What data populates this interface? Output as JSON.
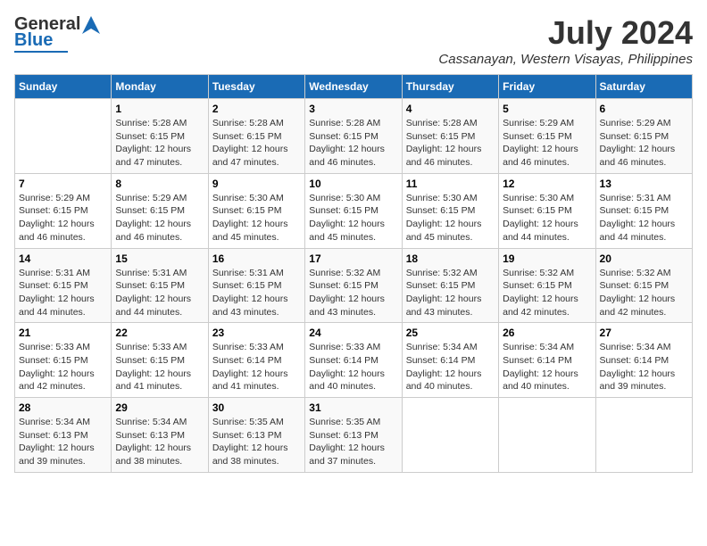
{
  "header": {
    "logo_line1": "General",
    "logo_line2": "Blue",
    "month_year": "July 2024",
    "location": "Cassanayan, Western Visayas, Philippines"
  },
  "columns": [
    "Sunday",
    "Monday",
    "Tuesday",
    "Wednesday",
    "Thursday",
    "Friday",
    "Saturday"
  ],
  "weeks": [
    [
      {
        "day": "",
        "info": ""
      },
      {
        "day": "1",
        "info": "Sunrise: 5:28 AM\nSunset: 6:15 PM\nDaylight: 12 hours\nand 47 minutes."
      },
      {
        "day": "2",
        "info": "Sunrise: 5:28 AM\nSunset: 6:15 PM\nDaylight: 12 hours\nand 47 minutes."
      },
      {
        "day": "3",
        "info": "Sunrise: 5:28 AM\nSunset: 6:15 PM\nDaylight: 12 hours\nand 46 minutes."
      },
      {
        "day": "4",
        "info": "Sunrise: 5:28 AM\nSunset: 6:15 PM\nDaylight: 12 hours\nand 46 minutes."
      },
      {
        "day": "5",
        "info": "Sunrise: 5:29 AM\nSunset: 6:15 PM\nDaylight: 12 hours\nand 46 minutes."
      },
      {
        "day": "6",
        "info": "Sunrise: 5:29 AM\nSunset: 6:15 PM\nDaylight: 12 hours\nand 46 minutes."
      }
    ],
    [
      {
        "day": "7",
        "info": "Sunrise: 5:29 AM\nSunset: 6:15 PM\nDaylight: 12 hours\nand 46 minutes."
      },
      {
        "day": "8",
        "info": "Sunrise: 5:29 AM\nSunset: 6:15 PM\nDaylight: 12 hours\nand 46 minutes."
      },
      {
        "day": "9",
        "info": "Sunrise: 5:30 AM\nSunset: 6:15 PM\nDaylight: 12 hours\nand 45 minutes."
      },
      {
        "day": "10",
        "info": "Sunrise: 5:30 AM\nSunset: 6:15 PM\nDaylight: 12 hours\nand 45 minutes."
      },
      {
        "day": "11",
        "info": "Sunrise: 5:30 AM\nSunset: 6:15 PM\nDaylight: 12 hours\nand 45 minutes."
      },
      {
        "day": "12",
        "info": "Sunrise: 5:30 AM\nSunset: 6:15 PM\nDaylight: 12 hours\nand 44 minutes."
      },
      {
        "day": "13",
        "info": "Sunrise: 5:31 AM\nSunset: 6:15 PM\nDaylight: 12 hours\nand 44 minutes."
      }
    ],
    [
      {
        "day": "14",
        "info": "Sunrise: 5:31 AM\nSunset: 6:15 PM\nDaylight: 12 hours\nand 44 minutes."
      },
      {
        "day": "15",
        "info": "Sunrise: 5:31 AM\nSunset: 6:15 PM\nDaylight: 12 hours\nand 44 minutes."
      },
      {
        "day": "16",
        "info": "Sunrise: 5:31 AM\nSunset: 6:15 PM\nDaylight: 12 hours\nand 43 minutes."
      },
      {
        "day": "17",
        "info": "Sunrise: 5:32 AM\nSunset: 6:15 PM\nDaylight: 12 hours\nand 43 minutes."
      },
      {
        "day": "18",
        "info": "Sunrise: 5:32 AM\nSunset: 6:15 PM\nDaylight: 12 hours\nand 43 minutes."
      },
      {
        "day": "19",
        "info": "Sunrise: 5:32 AM\nSunset: 6:15 PM\nDaylight: 12 hours\nand 42 minutes."
      },
      {
        "day": "20",
        "info": "Sunrise: 5:32 AM\nSunset: 6:15 PM\nDaylight: 12 hours\nand 42 minutes."
      }
    ],
    [
      {
        "day": "21",
        "info": "Sunrise: 5:33 AM\nSunset: 6:15 PM\nDaylight: 12 hours\nand 42 minutes."
      },
      {
        "day": "22",
        "info": "Sunrise: 5:33 AM\nSunset: 6:15 PM\nDaylight: 12 hours\nand 41 minutes."
      },
      {
        "day": "23",
        "info": "Sunrise: 5:33 AM\nSunset: 6:14 PM\nDaylight: 12 hours\nand 41 minutes."
      },
      {
        "day": "24",
        "info": "Sunrise: 5:33 AM\nSunset: 6:14 PM\nDaylight: 12 hours\nand 40 minutes."
      },
      {
        "day": "25",
        "info": "Sunrise: 5:34 AM\nSunset: 6:14 PM\nDaylight: 12 hours\nand 40 minutes."
      },
      {
        "day": "26",
        "info": "Sunrise: 5:34 AM\nSunset: 6:14 PM\nDaylight: 12 hours\nand 40 minutes."
      },
      {
        "day": "27",
        "info": "Sunrise: 5:34 AM\nSunset: 6:14 PM\nDaylight: 12 hours\nand 39 minutes."
      }
    ],
    [
      {
        "day": "28",
        "info": "Sunrise: 5:34 AM\nSunset: 6:13 PM\nDaylight: 12 hours\nand 39 minutes."
      },
      {
        "day": "29",
        "info": "Sunrise: 5:34 AM\nSunset: 6:13 PM\nDaylight: 12 hours\nand 38 minutes."
      },
      {
        "day": "30",
        "info": "Sunrise: 5:35 AM\nSunset: 6:13 PM\nDaylight: 12 hours\nand 38 minutes."
      },
      {
        "day": "31",
        "info": "Sunrise: 5:35 AM\nSunset: 6:13 PM\nDaylight: 12 hours\nand 37 minutes."
      },
      {
        "day": "",
        "info": ""
      },
      {
        "day": "",
        "info": ""
      },
      {
        "day": "",
        "info": ""
      }
    ]
  ]
}
